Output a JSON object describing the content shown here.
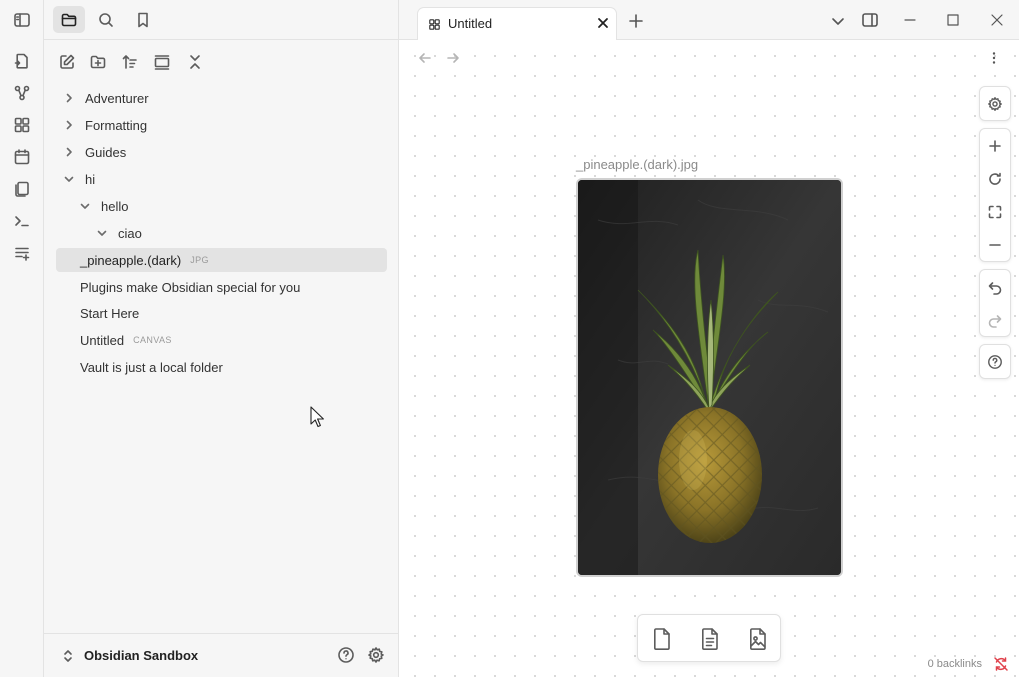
{
  "colors": {
    "accent": "#7c5cdc",
    "sync_error": "#e0414b",
    "sidebar_bg": "#f6f6f6",
    "selected_bg": "#e3e3e3"
  },
  "ribbon": {
    "items": [
      "sidebar-toggle-icon",
      "open-quick-switcher-icon",
      "graph-view-icon",
      "canvas-icon",
      "daily-note-icon",
      "templates-icon",
      "command-palette-icon",
      "bases-icon"
    ]
  },
  "sidebar": {
    "tabs": [
      "files",
      "search",
      "bookmarks"
    ],
    "nav_buttons": [
      "new-note",
      "new-folder",
      "change-sort-order",
      "auto-reveal",
      "collapse-all"
    ],
    "tree": [
      {
        "label": "Adventurer",
        "type": "folder",
        "expanded": false,
        "depth": 0
      },
      {
        "label": "Formatting",
        "type": "folder",
        "expanded": false,
        "depth": 0
      },
      {
        "label": "Guides",
        "type": "folder",
        "expanded": false,
        "depth": 0
      },
      {
        "label": "hi",
        "type": "folder",
        "expanded": true,
        "depth": 0
      },
      {
        "label": "hello",
        "type": "folder",
        "expanded": true,
        "depth": 1
      },
      {
        "label": "ciao",
        "type": "folder",
        "expanded": true,
        "depth": 2
      },
      {
        "label": "_pineapple.(dark)",
        "type": "file",
        "tag": "JPG",
        "selected": true,
        "depth": 0
      },
      {
        "label": "Plugins make Obsidian special for you",
        "type": "file",
        "depth": 0
      },
      {
        "label": "Start Here",
        "type": "file",
        "depth": 0
      },
      {
        "label": "Untitled",
        "type": "file",
        "tag": "CANVAS",
        "depth": 0
      },
      {
        "label": "Vault is just a local folder",
        "type": "file",
        "depth": 0
      }
    ],
    "vault_name": "Obsidian Sandbox"
  },
  "tab": {
    "title": "Untitled"
  },
  "canvas": {
    "node_label": "_pineapple.(dark).jpg",
    "controls_top": [
      "settings"
    ],
    "controls_zoom": [
      "zoom-in",
      "reset-zoom",
      "zoom-to-fit",
      "zoom-out"
    ],
    "controls_history": [
      "undo",
      "redo"
    ],
    "controls_help": [
      "help"
    ],
    "add_items": [
      "add-card",
      "add-note-from-vault",
      "add-media-from-vault"
    ]
  },
  "status": {
    "backlinks": "0 backlinks"
  }
}
